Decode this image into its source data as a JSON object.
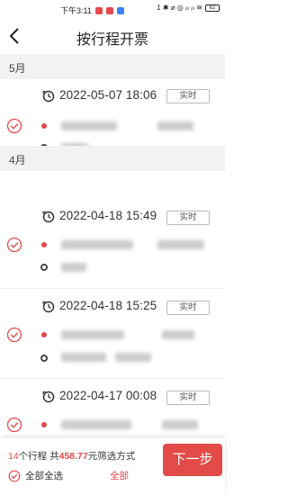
{
  "status_bar": {
    "time": "下午3:11",
    "right_text": "1 ✱ ⌀ ◎ ᵢₗₗ ᵢₗₗ ≋",
    "battery": "62"
  },
  "header": {
    "title": "按行程开票"
  },
  "groups": [
    {
      "month": "5月",
      "trips": [
        {
          "datetime": "2022-05-07 18:06",
          "badge": "实时",
          "selected": true
        }
      ]
    },
    {
      "month": "4月",
      "trips": [
        {
          "datetime": "2022-04-18 15:49",
          "badge": "实时",
          "selected": true
        },
        {
          "datetime": "2022-04-18 15:25",
          "badge": "实时",
          "selected": true
        },
        {
          "datetime": "2022-04-17 00:08",
          "badge": "实时",
          "selected": true
        }
      ]
    }
  ],
  "footer": {
    "trip_count": "14",
    "trip_count_unit": "个行程",
    "total_prefix": "共",
    "total_amount": "458.77",
    "total_unit": "元",
    "filter_label": "筛选方式",
    "select_all_label": "全部全选",
    "all_label": "全部",
    "next_label": "下一步"
  },
  "colors": {
    "accent": "#e14a4a",
    "section_bg": "#f2f2f2"
  },
  "icons": [
    "back-arrow-icon",
    "clock-icon",
    "checked-circle-icon",
    "origin-dot-icon",
    "destination-dot-icon"
  ]
}
